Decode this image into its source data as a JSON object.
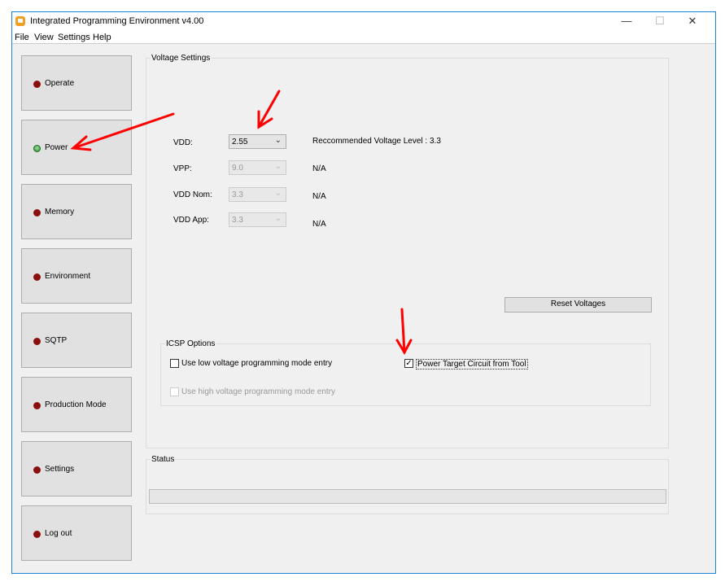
{
  "window": {
    "title": "Integrated Programming Environment v4.00",
    "minimize": "—",
    "maximize": "☐",
    "close": "✕"
  },
  "menu": [
    "File",
    "View",
    "Settings",
    "Help"
  ],
  "sidebar": [
    {
      "label": "Operate",
      "status": "inactive"
    },
    {
      "label": "Power",
      "status": "active"
    },
    {
      "label": "Memory",
      "status": "inactive"
    },
    {
      "label": "Environment",
      "status": "inactive"
    },
    {
      "label": "SQTP",
      "status": "inactive"
    },
    {
      "label": "Production Mode",
      "status": "inactive"
    },
    {
      "label": "Settings",
      "status": "inactive"
    },
    {
      "label": "Log out",
      "status": "inactive"
    }
  ],
  "voltage": {
    "title": "Voltage Settings",
    "rows": [
      {
        "label": "VDD:",
        "value": "2.55",
        "info": "Reccommended Voltage Level : 3.3",
        "enabled": true
      },
      {
        "label": "VPP:",
        "value": "9.0",
        "info": "N/A",
        "enabled": false
      },
      {
        "label": "VDD Nom:",
        "value": "3.3",
        "info": "N/A",
        "enabled": false
      },
      {
        "label": "VDD App:",
        "value": "3.3",
        "info": "N/A",
        "enabled": false
      }
    ],
    "reset_label": "Reset Voltages"
  },
  "icsp": {
    "title": "ICSP Options",
    "low_voltage": {
      "label": "Use low voltage programming mode entry",
      "checked": false
    },
    "power_target": {
      "label": "Power Target Circuit from Tool",
      "checked": true
    },
    "high_voltage": {
      "label": "Use high voltage programming mode entry",
      "checked": false
    }
  },
  "status": {
    "title": "Status",
    "progress": 0
  },
  "colors": {
    "annotation": "#ff0000",
    "led_off": "#8b0f0f",
    "led_on": "#2b8a2b"
  }
}
